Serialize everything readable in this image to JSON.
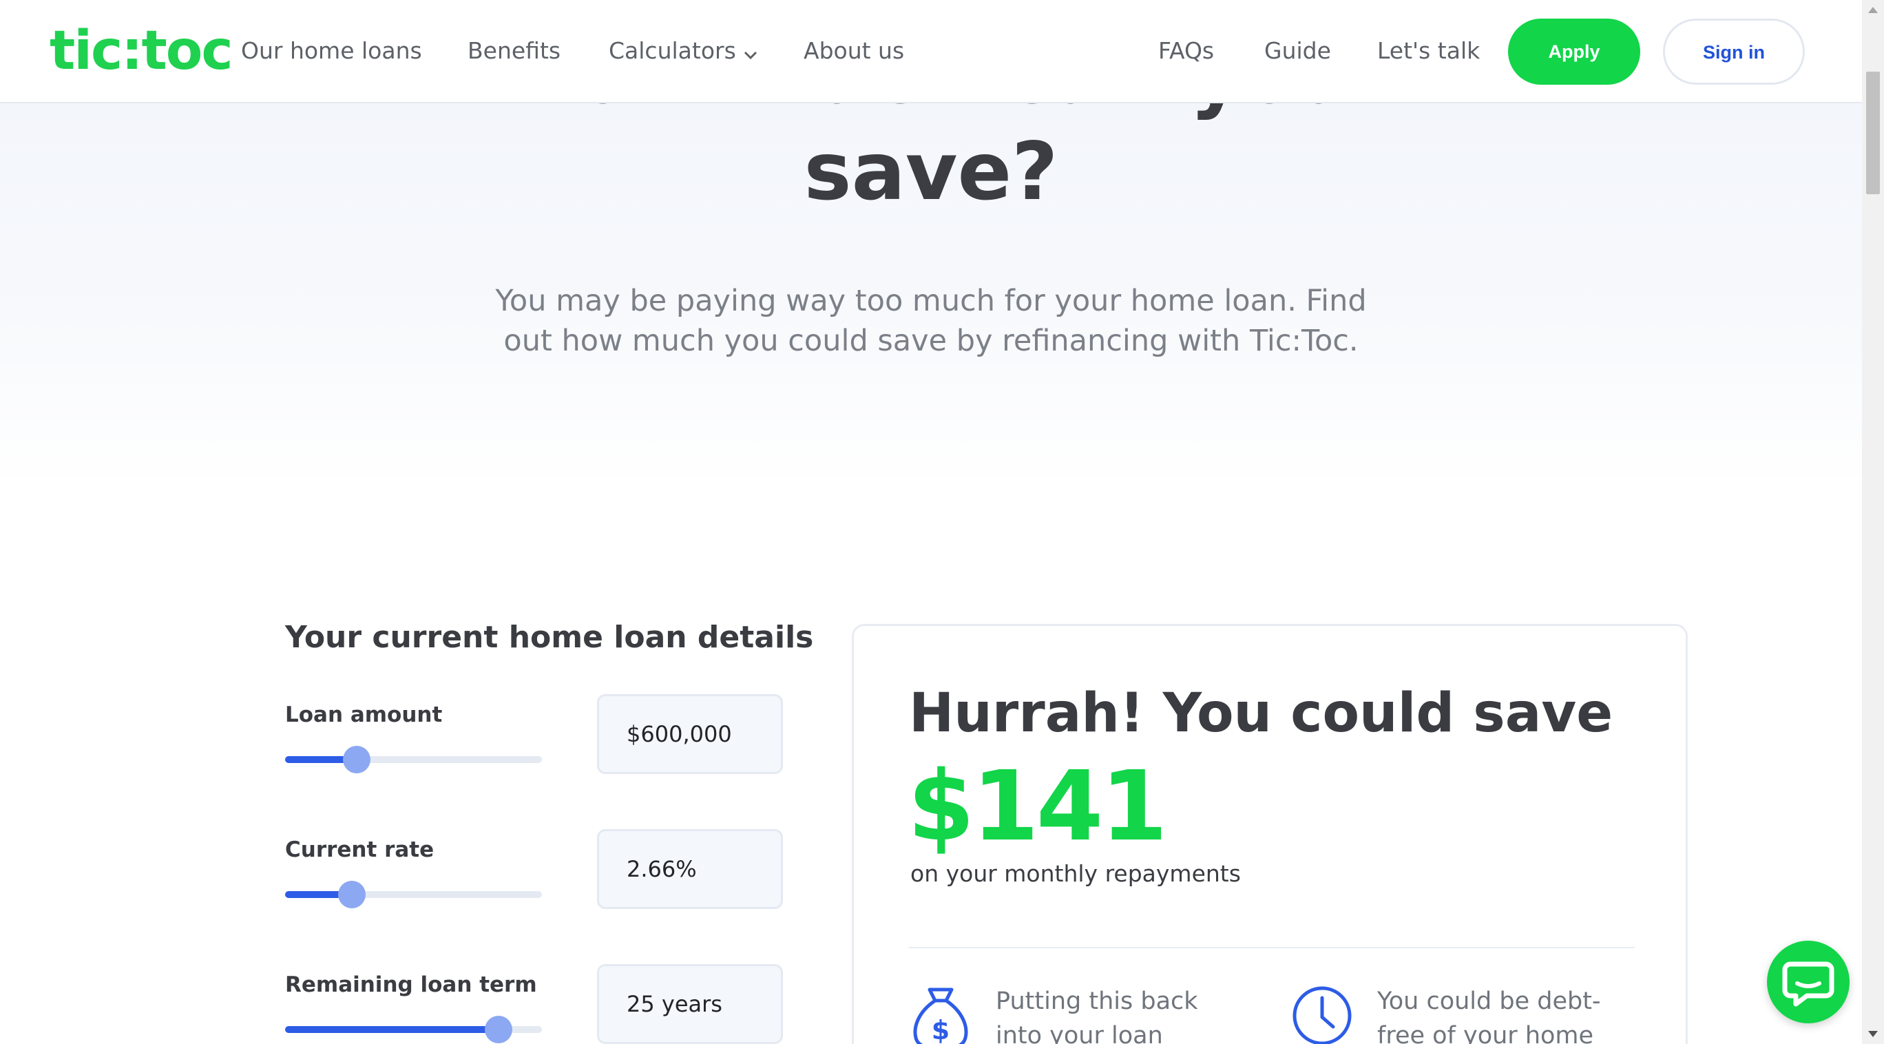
{
  "brand": {
    "logo_text": "tic:toc",
    "color": "#1fd14f"
  },
  "nav": {
    "links": [
      "Our home loans",
      "Benefits",
      "Calculators",
      "About us"
    ],
    "right_links": [
      "FAQs",
      "Guide",
      "Let's talk"
    ],
    "apply_label": "Apply",
    "signin_label": "Sign in"
  },
  "hero": {
    "title_line1": "How much can you",
    "title_line2": "save?",
    "subtitle": "You may be paying way too much for your home loan. Find out how much you could save by refinancing with Tic:Toc."
  },
  "calculator": {
    "section_title": "Your current home loan details",
    "fields": [
      {
        "label": "Loan amount",
        "value": "$600,000",
        "slider_fraction": 0.28
      },
      {
        "label": "Current rate",
        "value": "2.66%",
        "slider_fraction": 0.26
      },
      {
        "label": "Remaining loan term",
        "value": "25 years",
        "slider_fraction": 0.83
      }
    ]
  },
  "result": {
    "headline": "Hurrah! You could save",
    "amount": "$141",
    "caption": "on your monthly repayments",
    "benefits": [
      {
        "icon": "money-bag-icon",
        "text": "Putting this back into your loan could save"
      },
      {
        "icon": "clock-icon",
        "text": "You could be debt-free of your home loan this"
      }
    ]
  },
  "colors": {
    "accent_green": "#12d549",
    "primary_blue": "#2d5ce6",
    "text_dark": "#3a3c41"
  },
  "chat": {
    "icon": "chat-icon"
  }
}
